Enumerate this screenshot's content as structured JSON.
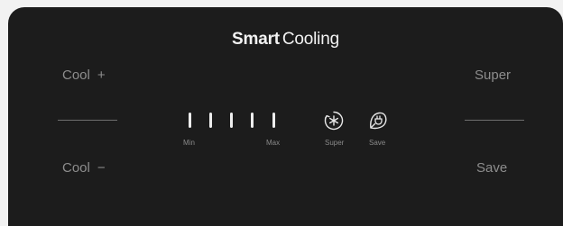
{
  "header": {
    "title_bold": "Smart",
    "title_light": "Cooling"
  },
  "left_controls": {
    "cool_up_label": "Cool",
    "cool_up_symbol": "+",
    "cool_down_label": "Cool",
    "cool_down_symbol": "−"
  },
  "right_controls": {
    "super_label": "Super",
    "save_label": "Save"
  },
  "level_indicator": {
    "bar_count": 5,
    "min_label": "Min",
    "max_label": "Max"
  },
  "modes": {
    "super_icon": "snowflake-icon",
    "super_label": "Super",
    "save_icon": "eco-plug-icon",
    "save_label": "Save"
  }
}
